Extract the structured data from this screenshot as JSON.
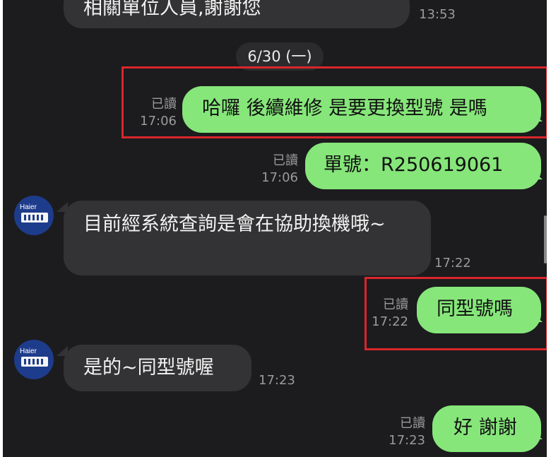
{
  "chat": {
    "messages": [
      {
        "id": "m0",
        "text": "相關單位人員,謝謝您",
        "time": "13:53"
      },
      {
        "id": "m1",
        "read": "已讀",
        "time": "17:06",
        "text": "哈囉 後續維修 是要更換型號 是嗎"
      },
      {
        "id": "m2",
        "read": "已讀",
        "time": "17:06",
        "text": "單號：R250619061"
      },
      {
        "id": "m3",
        "text": "目前經系統查詢是會在協助換機哦~",
        "time": "17:22"
      },
      {
        "id": "m4",
        "read": "已讀",
        "time": "17:22",
        "text": "同型號嗎"
      },
      {
        "id": "m5",
        "text": "是的~同型號喔",
        "time": "17:23"
      },
      {
        "id": "m6",
        "read": "已讀",
        "time": "17:23",
        "text": "好 謝謝"
      }
    ],
    "date_separator": "6/30 (一)",
    "avatar_brand": "Haier"
  },
  "colors": {
    "background": "#1c1c1e",
    "outgoing_bubble": "#86e67a",
    "incoming_bubble": "#333335",
    "highlight_box": "#d9262c"
  }
}
